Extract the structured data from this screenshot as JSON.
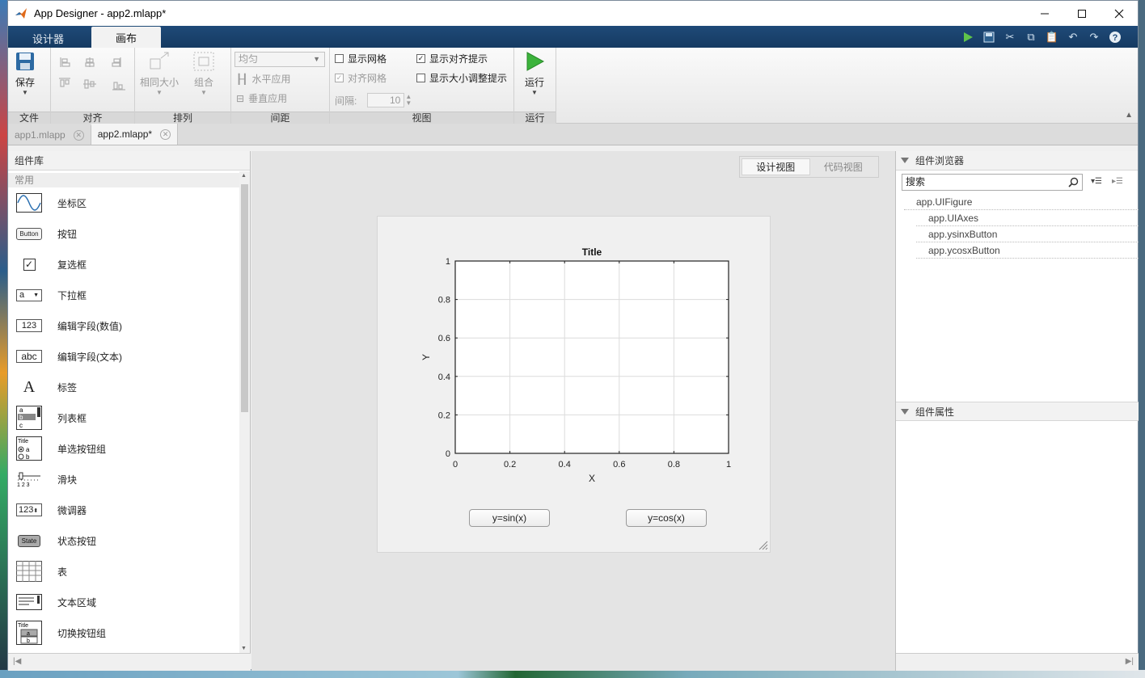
{
  "window": {
    "title": "App Designer - app2.mlapp*"
  },
  "toolstrip_tabs": [
    {
      "label": "设计器"
    },
    {
      "label": "画布"
    }
  ],
  "ribbon": {
    "file": {
      "group_label": "文件",
      "save_label": "保存"
    },
    "align": {
      "group_label": "对齐"
    },
    "arrange": {
      "group_label": "排列",
      "same_size_label": "相同大小",
      "group_btn_label": "组合"
    },
    "spacing": {
      "group_label": "间距",
      "dropdown_value": "均匀",
      "horizontal_label": "水平应用",
      "vertical_label": "垂直应用",
      "gap_label": "间隔:",
      "gap_value": "10"
    },
    "view": {
      "group_label": "视图",
      "show_grid": "显示网格",
      "snap_grid": "对齐网格",
      "show_align_hints": "显示对齐提示",
      "show_resize_hints": "显示大小调整提示"
    },
    "run": {
      "group_label": "运行",
      "run_label": "运行"
    }
  },
  "doc_tabs": [
    {
      "label": "app1.mlapp"
    },
    {
      "label": "app2.mlapp*"
    }
  ],
  "library": {
    "title": "组件库",
    "category": "常用",
    "items": [
      {
        "label": "坐标区",
        "icon": "axes-icon"
      },
      {
        "label": "按钮",
        "icon": "button-icon",
        "icon_text": "Button"
      },
      {
        "label": "复选框",
        "icon": "checkbox-icon"
      },
      {
        "label": "下拉框",
        "icon": "dropdown-icon",
        "icon_text": "a"
      },
      {
        "label": "编辑字段(数值)",
        "icon": "numeric-field-icon",
        "icon_text": "123"
      },
      {
        "label": "编辑字段(文本)",
        "icon": "text-field-icon",
        "icon_text": "abc"
      },
      {
        "label": "标签",
        "icon": "label-icon",
        "icon_text": "A"
      },
      {
        "label": "列表框",
        "icon": "listbox-icon"
      },
      {
        "label": "单选按钮组",
        "icon": "radio-group-icon"
      },
      {
        "label": "滑块",
        "icon": "slider-icon"
      },
      {
        "label": "微调器",
        "icon": "spinner-icon",
        "icon_text": "123"
      },
      {
        "label": "状态按钮",
        "icon": "state-button-icon",
        "icon_text": "State"
      },
      {
        "label": "表",
        "icon": "table-icon"
      },
      {
        "label": "文本区域",
        "icon": "text-area-icon"
      },
      {
        "label": "切换按钮组",
        "icon": "toggle-group-icon"
      }
    ]
  },
  "canvas": {
    "view_toggle": {
      "design": "设计视图",
      "code": "代码视图"
    },
    "axes": {
      "title": "Title",
      "xlabel": "X",
      "ylabel": "Y"
    },
    "buttons": {
      "sin": "y=sin(x)",
      "cos": "y=cos(x)"
    }
  },
  "chart_data": {
    "type": "line",
    "title": "Title",
    "xlabel": "X",
    "ylabel": "Y",
    "xlim": [
      0,
      1
    ],
    "ylim": [
      0,
      1
    ],
    "xticks": [
      "0",
      "0.2",
      "0.4",
      "0.6",
      "0.8",
      "1"
    ],
    "yticks": [
      "0",
      "0.2",
      "0.4",
      "0.6",
      "0.8",
      "1"
    ],
    "grid": true,
    "series": []
  },
  "browser": {
    "title": "组件浏览器",
    "search_placeholder": "搜索",
    "tree": [
      "app.UIFigure",
      "app.UIAxes",
      "app.ysinxButton",
      "app.ycosxButton"
    ],
    "props_title": "组件属性"
  },
  "colors": {
    "accent_blue": "#1f4a78",
    "run_green": "#2a9a2a"
  }
}
